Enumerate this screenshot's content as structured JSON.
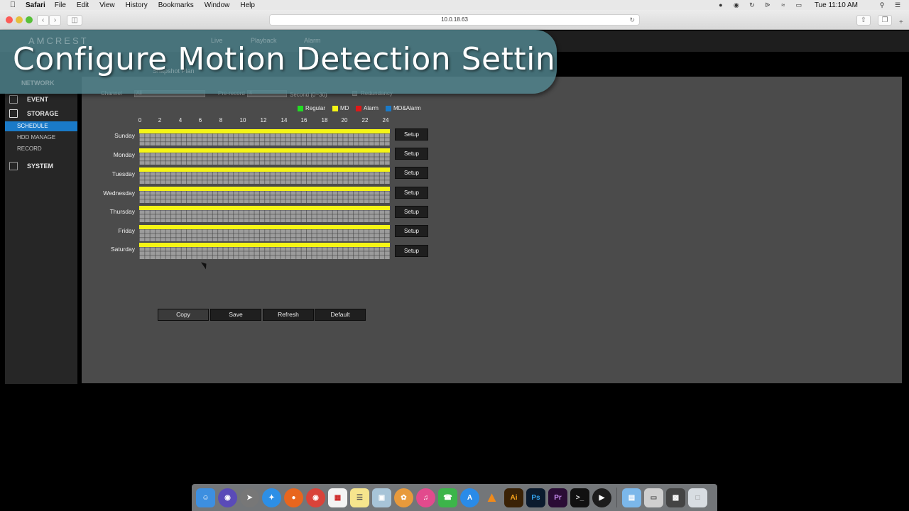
{
  "os_menubar": {
    "app": "Safari",
    "items": [
      "File",
      "Edit",
      "View",
      "History",
      "Bookmarks",
      "Window",
      "Help"
    ],
    "clock": "Tue 11:10 AM"
  },
  "browser": {
    "url": "10.0.18.63"
  },
  "banner": {
    "title": "Configure Motion Detection Settings",
    "ghost_brand": "AMCREST",
    "ghost_nav": [
      "Live",
      "Playback",
      "Alarm"
    ],
    "ghost_network": "NETWORK",
    "ghost_tab": "Snapshot Plan"
  },
  "sidebar": {
    "event": "EVENT",
    "storage": "STORAGE",
    "schedule": "SCHEDULE",
    "hdd_manage": "HDD MANAGE",
    "record": "RECORD",
    "system": "SYSTEM"
  },
  "form": {
    "channel_label": "Channel",
    "channel_value": "All",
    "prerecord_label": "Pre-record",
    "prerecord_value": "4",
    "prerecord_unit": "Second (0~30)",
    "redundancy_label": "Redundancy"
  },
  "legend": [
    {
      "label": "Regular",
      "color": "#22dd22"
    },
    {
      "label": "MD",
      "color": "#f5f515"
    },
    {
      "label": "Alarm",
      "color": "#e01818"
    },
    {
      "label": "MD&Alarm",
      "color": "#1a7ac8"
    }
  ],
  "schedule": {
    "hours": [
      "0",
      "2",
      "4",
      "6",
      "8",
      "10",
      "12",
      "14",
      "16",
      "18",
      "20",
      "22",
      "24"
    ],
    "days": [
      "Sunday",
      "Monday",
      "Tuesday",
      "Wednesday",
      "Thursday",
      "Friday",
      "Saturday"
    ],
    "setup_label": "Setup",
    "md_color": "#f5f515"
  },
  "actions": {
    "copy": "Copy",
    "save": "Save",
    "refresh": "Refresh",
    "default": "Default"
  }
}
